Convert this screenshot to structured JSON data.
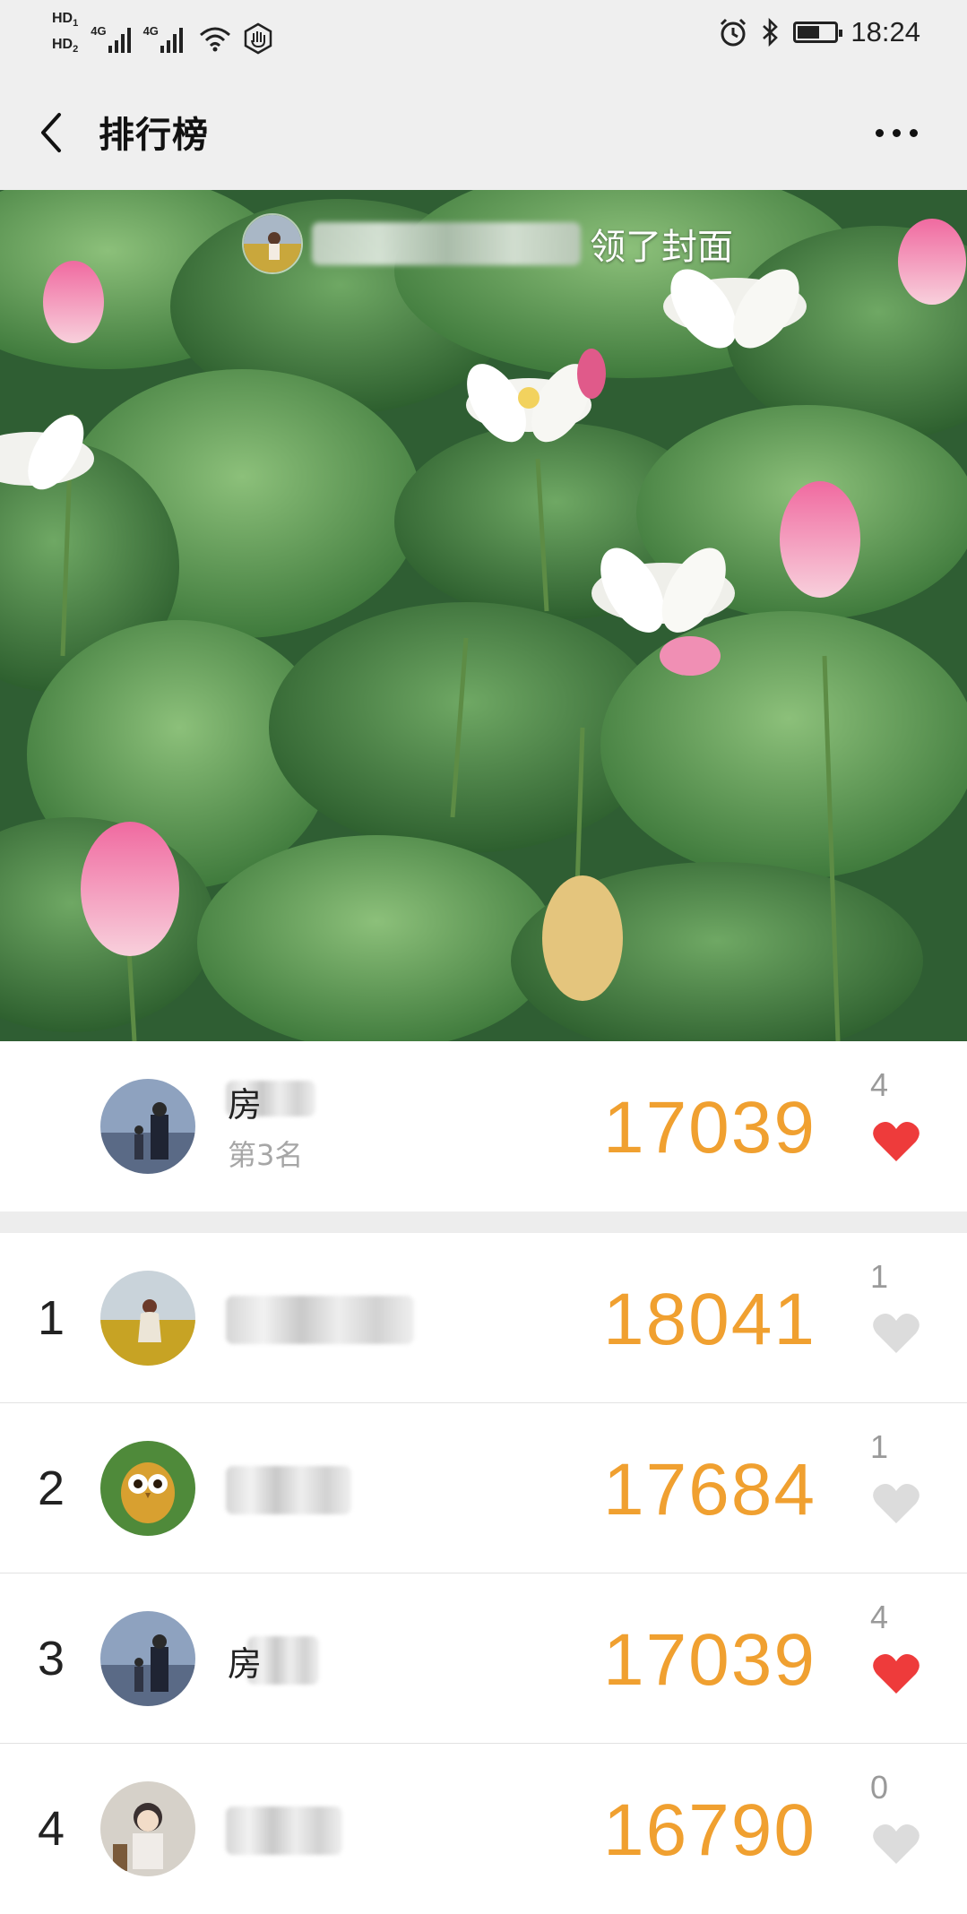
{
  "status_bar": {
    "sim1": "HD",
    "sim1_index": "1",
    "sim2": "HD",
    "sim2_index": "2",
    "network1": "4G",
    "network2": "4G",
    "time": "18:24",
    "battery_level": 0.6,
    "icons": [
      "alarm-icon",
      "bluetooth-icon",
      "wifi-icon",
      "hand-icon"
    ]
  },
  "nav": {
    "title": "排行榜",
    "back_icon": "chevron-left-icon",
    "more_icon": "more-dots-icon"
  },
  "cover": {
    "caption": "领了封面"
  },
  "my_rank": {
    "name_hint": "房",
    "position_label": "第3名",
    "steps": "17039",
    "likes": "4",
    "liked": true
  },
  "leaderboard": [
    {
      "rank": "1",
      "name_hint": "",
      "steps": "18041",
      "likes": "1",
      "liked": false
    },
    {
      "rank": "2",
      "name_hint": "",
      "steps": "17684",
      "likes": "1",
      "liked": false
    },
    {
      "rank": "3",
      "name_hint": "房",
      "steps": "17039",
      "likes": "4",
      "liked": true
    },
    {
      "rank": "4",
      "name_hint": "",
      "steps": "16790",
      "likes": "0",
      "liked": false
    }
  ],
  "colors": {
    "steps": "#f0a030",
    "heart_liked": "#ee3b3b",
    "heart_unliked": "#dcdcdc",
    "header_bg": "#efefef"
  }
}
